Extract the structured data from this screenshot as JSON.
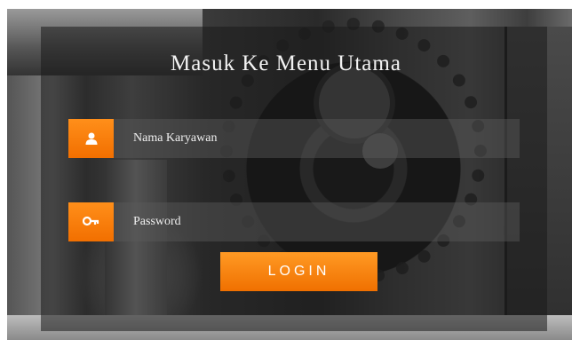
{
  "form": {
    "title": "Masuk Ke Menu Utama",
    "username": {
      "placeholder": "Nama Karyawan",
      "icon": "user-icon"
    },
    "password": {
      "placeholder": "Password",
      "icon": "key-icon"
    },
    "login_label": "LOGIN"
  },
  "colors": {
    "accent": "#f7830f",
    "panel": "#191919",
    "text": "#f2f2f2"
  }
}
